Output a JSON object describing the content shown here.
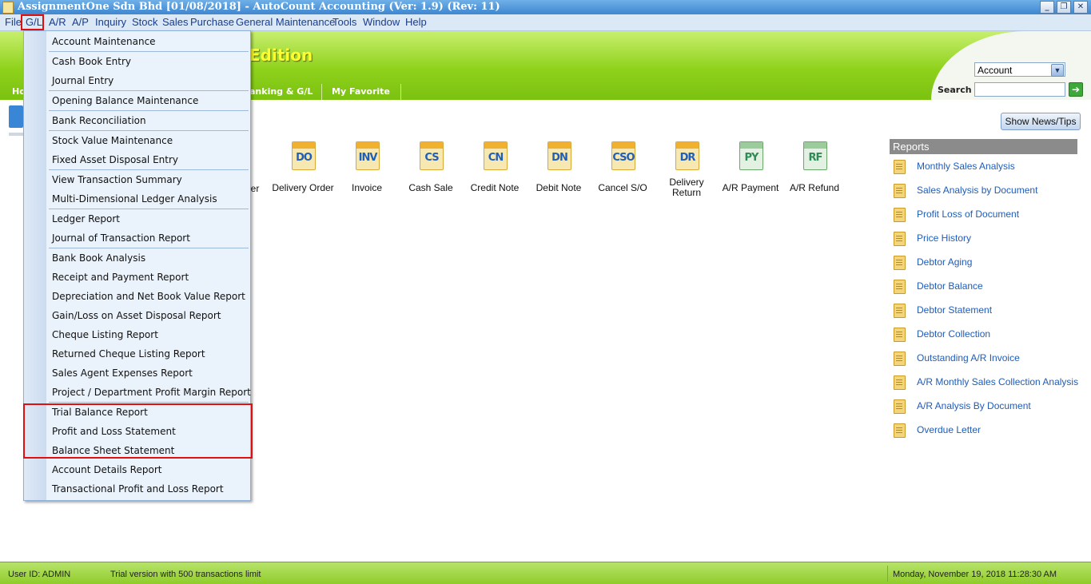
{
  "window": {
    "title": "AssignmentOne Sdn Bhd [01/08/2018] - AutoCount Accounting (Ver: 1.9) (Rev: 11)",
    "buttons": {
      "minimize": "_",
      "restore": "❐",
      "close": "✕"
    }
  },
  "menubar": {
    "items": [
      "File",
      "G/L",
      "A/R",
      "A/P",
      "Inquiry",
      "Stock",
      "Sales",
      "Purchase",
      "General Maintenance",
      "Tools",
      "Window",
      "Help"
    ]
  },
  "banner": {
    "edition": "Edition"
  },
  "tabs": [
    "Ho",
    "anking & G/L",
    "My Favorite"
  ],
  "search": {
    "category": "Account",
    "label": "Search :",
    "value": ""
  },
  "gl_menu": {
    "items": [
      "Account Maintenance",
      "Cash Book Entry",
      "Journal Entry",
      "Opening Balance Maintenance",
      "Bank Reconciliation",
      "Stock Value Maintenance",
      "Fixed Asset Disposal Entry",
      "View Transaction Summary",
      "Multi-Dimensional Ledger Analysis",
      "Ledger Report",
      "Journal of Transaction Report",
      "Bank Book Analysis",
      "Receipt and Payment Report",
      "Depreciation and Net Book Value Report",
      "Gain/Loss on Asset Disposal Report",
      "Cheque Listing Report",
      "Returned Cheque Listing Report",
      "Sales Agent Expenses Report",
      "Project / Department Profit Margin Report",
      "Trial Balance Report",
      "Profit and Loss Statement",
      "Balance Sheet Statement",
      "Account Details Report",
      "Transactional Profit and Loss Report"
    ]
  },
  "shortcuts": {
    "partial_label": "der",
    "items": [
      {
        "abbr": "DO",
        "label": "Delivery Order",
        "color": "#1f5fb8"
      },
      {
        "abbr": "INV",
        "label": "Invoice",
        "color": "#1f5fb8"
      },
      {
        "abbr": "CS",
        "label": "Cash Sale",
        "color": "#1f5fb8"
      },
      {
        "abbr": "CN",
        "label": "Credit Note",
        "color": "#1f5fb8"
      },
      {
        "abbr": "DN",
        "label": "Debit Note",
        "color": "#1f5fb8"
      },
      {
        "abbr": "CSO",
        "label": "Cancel S/O",
        "color": "#1f5fb8"
      },
      {
        "abbr": "DR",
        "label": "Delivery Return",
        "color": "#1f5fb8"
      },
      {
        "abbr": "PY",
        "label": "A/R Payment",
        "color": "#2e8b57"
      },
      {
        "abbr": "RF",
        "label": "A/R Refund",
        "color": "#2e8b57"
      }
    ]
  },
  "news_button": "Show News/Tips",
  "reports": {
    "header": "Reports",
    "items": [
      "Monthly Sales Analysis",
      "Sales Analysis by Document",
      "Profit  Loss of Document",
      "Price History",
      "Debtor Aging",
      "Debtor Balance",
      "Debtor Statement",
      "Debtor Collection",
      "Outstanding A/R Invoice",
      "A/R Monthly Sales  Collection Analysis",
      "A/R Analysis By Document",
      "Overdue Letter"
    ]
  },
  "status": {
    "user": "User ID: ADMIN",
    "trial": "Trial version with 500 transactions limit",
    "datetime": "Monday, November 19, 2018  11:28:30 AM"
  },
  "colors": {
    "banner_green": "#8fd21c",
    "link_blue": "#1f5cb8",
    "highlight_red": "#e01010"
  }
}
